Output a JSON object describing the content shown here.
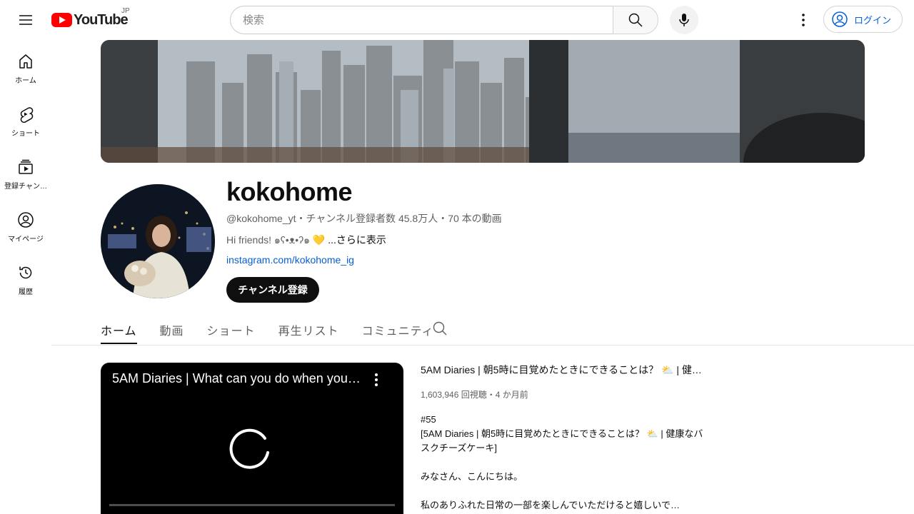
{
  "topbar": {
    "logo_text": "YouTube",
    "region": "JP",
    "search_placeholder": "検索",
    "login_label": "ログイン"
  },
  "guide": {
    "items": [
      {
        "label": "ホーム",
        "icon": "home-icon"
      },
      {
        "label": "ショート",
        "icon": "shorts-icon"
      },
      {
        "label": "登録チャン…",
        "icon": "subscriptions-icon"
      },
      {
        "label": "マイページ",
        "icon": "you-icon"
      },
      {
        "label": "履歴",
        "icon": "history-icon"
      }
    ]
  },
  "channel": {
    "name": "kokohome",
    "meta": "@kokohome_yt・チャンネル登録者数 45.8万人・70 本の動画",
    "description": "Hi friends! ๑ʕ•ᴥ•ʔ๑ 💛 ",
    "description_more": "...さらに表示",
    "link": "instagram.com/kokohome_ig",
    "subscribe_label": "チャンネル登録"
  },
  "tabs": [
    {
      "label": "ホーム",
      "active": true
    },
    {
      "label": "動画",
      "active": false
    },
    {
      "label": "ショート",
      "active": false
    },
    {
      "label": "再生リスト",
      "active": false
    },
    {
      "label": "コミュニティ",
      "active": false
    }
  ],
  "featured": {
    "player_title": "5AM Diaries | What can you do when you …",
    "title": "5AM Diaries | 朝5時に目覚めたときにできることは？ ⛅ | 健…",
    "stats": "1,603,946 回視聴・4 か月前",
    "desc_line1": "#55",
    "desc_line2": "[5AM Diaries | 朝5時に目覚めたときにできることは？ ⛅ | 健康なバスクチーズケーキ]",
    "desc_line3": "みなさん、こんにちは。",
    "desc_line4": "私のありふれた日常の一部を楽しんでいただけると嬉しいで…"
  }
}
